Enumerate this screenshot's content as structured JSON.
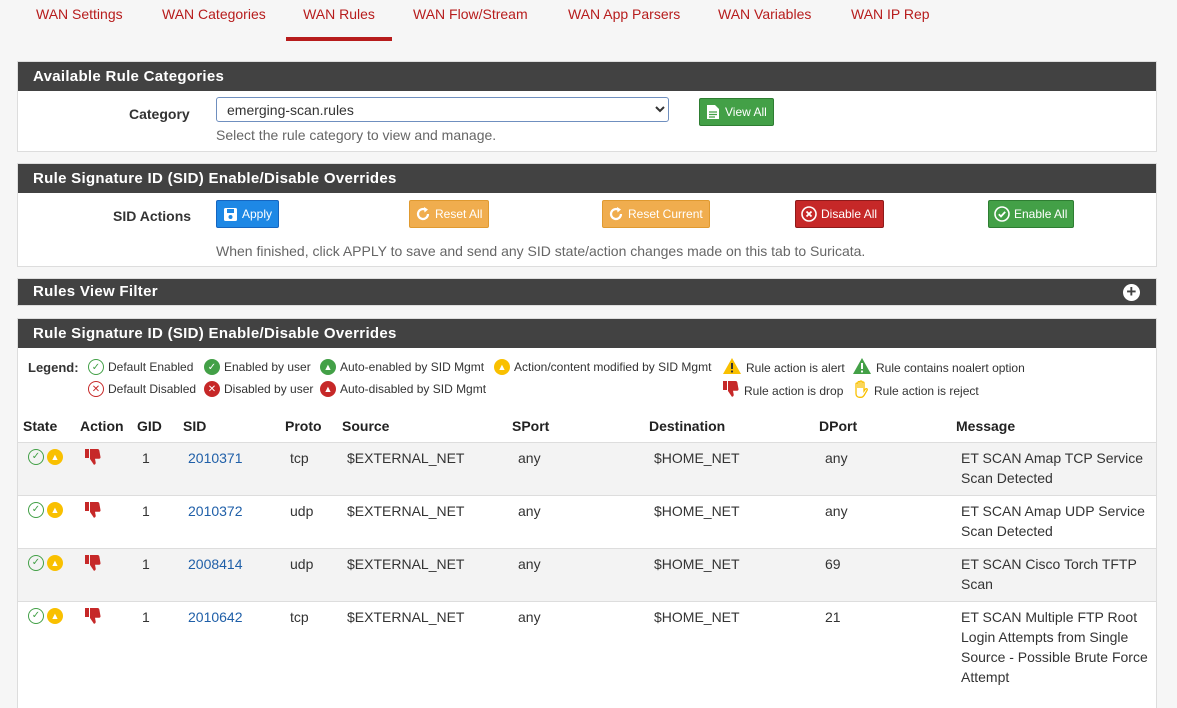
{
  "tabs": [
    "WAN Settings",
    "WAN Categories",
    "WAN Rules",
    "WAN Flow/Stream",
    "WAN App Parsers",
    "WAN Variables",
    "WAN IP Rep"
  ],
  "categories_panel": {
    "title": "Available Rule Categories",
    "category_label": "Category",
    "selected_category": "emerging-scan.rules",
    "help": "Select the rule category to view and manage.",
    "view_all": "View All"
  },
  "sid_panel": {
    "title": "Rule Signature ID (SID) Enable/Disable Overrides",
    "actions_label": "SID Actions",
    "apply": "Apply",
    "reset_all": "Reset All",
    "reset_current": "Reset Current",
    "disable_all": "Disable All",
    "enable_all": "Enable All",
    "help": "When finished, click APPLY to save and send any SID state/action changes made on this tab to Suricata."
  },
  "filter_panel": {
    "title": "Rules View Filter"
  },
  "rules_panel": {
    "title": "Rule Signature ID (SID) Enable/Disable Overrides",
    "legend_label": "Legend:",
    "legend": {
      "default_enabled": "Default Enabled",
      "enabled_by_user": "Enabled by user",
      "auto_enabled": "Auto-enabled by SID Mgmt",
      "action_modified": "Action/content modified by SID Mgmt",
      "action_alert": "Rule action is alert",
      "noalert": "Rule contains noalert option",
      "default_disabled": "Default Disabled",
      "disabled_by_user": "Disabled by user",
      "auto_disabled": "Auto-disabled by SID Mgmt",
      "action_drop": "Rule action is drop",
      "action_reject": "Rule action is reject"
    },
    "columns": [
      "State",
      "Action",
      "GID",
      "SID",
      "Proto",
      "Source",
      "SPort",
      "Destination",
      "DPort",
      "Message"
    ],
    "rows": [
      {
        "gid": "1",
        "sid": "2010371",
        "proto": "tcp",
        "source": "$EXTERNAL_NET",
        "sport": "any",
        "destination": "$HOME_NET",
        "dport": "any",
        "message": "ET SCAN Amap TCP Service Scan Detected"
      },
      {
        "gid": "1",
        "sid": "2010372",
        "proto": "udp",
        "source": "$EXTERNAL_NET",
        "sport": "any",
        "destination": "$HOME_NET",
        "dport": "any",
        "message": "ET SCAN Amap UDP Service Scan Detected"
      },
      {
        "gid": "1",
        "sid": "2008414",
        "proto": "udp",
        "source": "$EXTERNAL_NET",
        "sport": "any",
        "destination": "$HOME_NET",
        "dport": "69",
        "message": "ET SCAN Cisco Torch TFTP Scan"
      },
      {
        "gid": "1",
        "sid": "2010642",
        "proto": "tcp",
        "source": "$EXTERNAL_NET",
        "sport": "any",
        "destination": "$HOME_NET",
        "dport": "21",
        "message": "ET SCAN Multiple FTP Root Login Attempts from Single Source - Possible Brute Force Attempt"
      }
    ]
  },
  "colors": {
    "accent": "#b71c1c",
    "heading_bg": "#424242",
    "green": "#43a047",
    "blue": "#1e88e5",
    "orange": "#f0ad4e",
    "red": "#c62828",
    "yellow": "#f9c000"
  }
}
